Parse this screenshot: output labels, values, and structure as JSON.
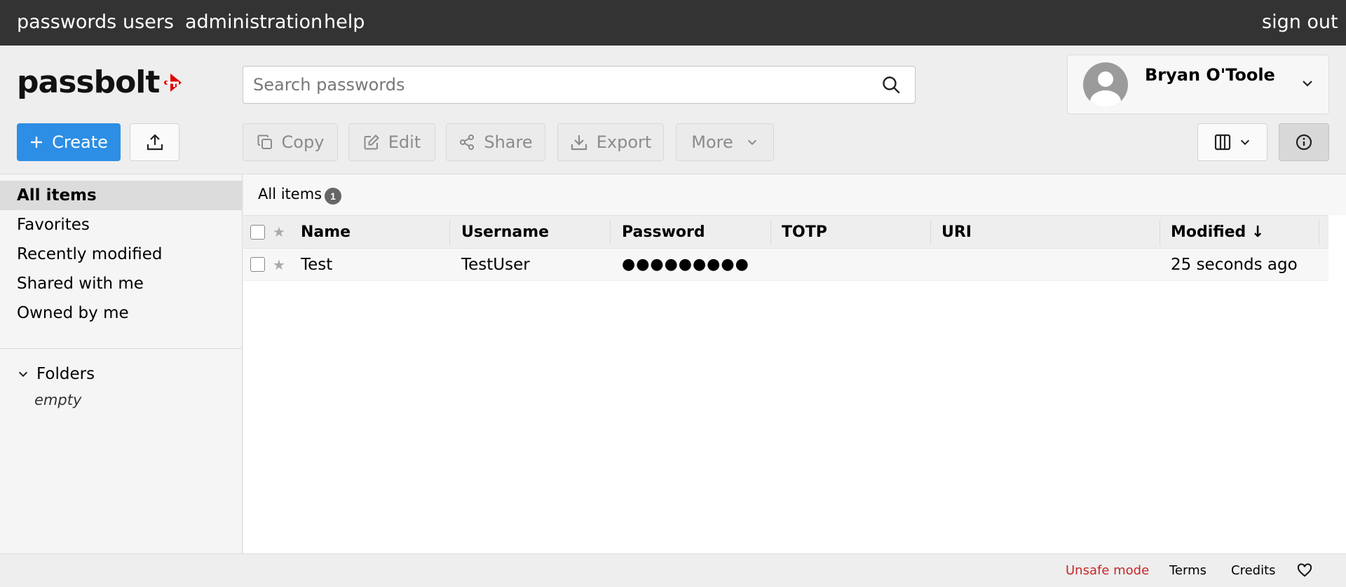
{
  "topnav": {
    "items": [
      "passwords",
      "users",
      "administration",
      "help"
    ],
    "signout": "sign out"
  },
  "brand": {
    "name": "passbolt",
    "accent_color": "#e10600"
  },
  "search": {
    "placeholder": "Search passwords",
    "value": "",
    "icon": "search-icon"
  },
  "profile": {
    "name": "Bryan O'Toole",
    "icon": "chevron-down-icon"
  },
  "toolbar": {
    "create_label": "Create",
    "upload_icon": "upload-icon",
    "copy_label": "Copy",
    "edit_label": "Edit",
    "share_label": "Share",
    "export_label": "Export",
    "more_label": "More",
    "columns_icon": "columns-icon",
    "info_icon": "info-icon",
    "primary_color": "#2c8ee4"
  },
  "sidebar": {
    "items": [
      {
        "label": "All items",
        "selected": true
      },
      {
        "label": "Favorites",
        "selected": false
      },
      {
        "label": "Recently modified",
        "selected": false
      },
      {
        "label": "Shared with me",
        "selected": false
      },
      {
        "label": "Owned by me",
        "selected": false
      }
    ],
    "folders_label": "Folders",
    "folders_empty": "empty"
  },
  "grid": {
    "breadcrumb": "All items",
    "count": "1",
    "columns": [
      "Name",
      "Username",
      "Password",
      "TOTP",
      "URI",
      "Modified ↓"
    ],
    "rows": [
      {
        "name": "Test",
        "username": "TestUser",
        "password": "●●●●●●●●●",
        "totp": "",
        "uri": "",
        "modified": "25 seconds ago"
      }
    ]
  },
  "footer": {
    "unsafe": "Unsafe mode",
    "unsafe_color": "#c62828",
    "terms": "Terms",
    "credits": "Credits",
    "heart_icon": "heart-icon"
  }
}
